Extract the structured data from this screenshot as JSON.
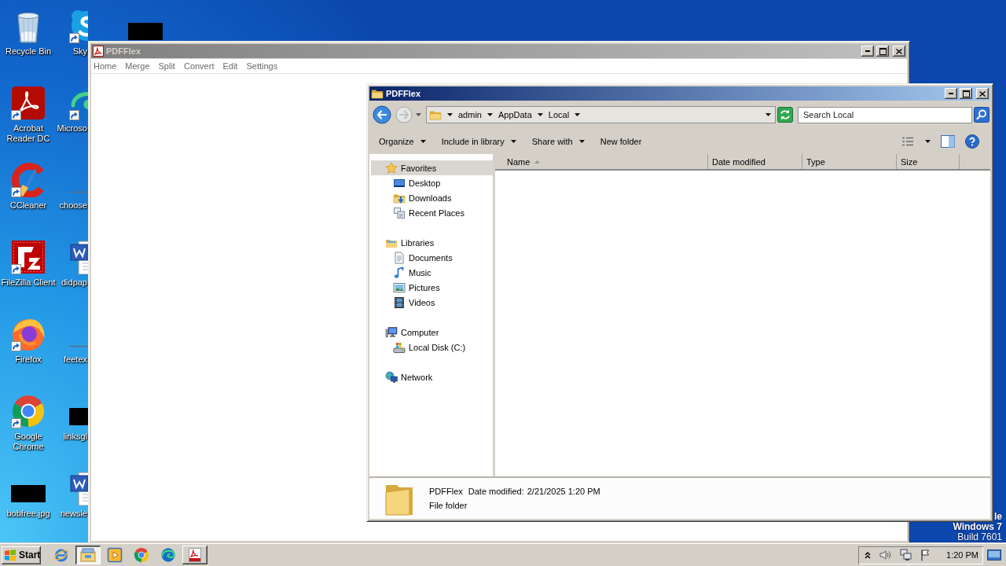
{
  "desktop": {
    "columns": [
      [
        {
          "label": "Recycle Bin",
          "kind": "recycle-bin",
          "shortcut": false
        },
        {
          "label": "Acrobat Reader DC",
          "kind": "acrobat",
          "shortcut": true
        },
        {
          "label": "CCleaner",
          "kind": "ccleaner",
          "shortcut": true
        },
        {
          "label": "FileZilla Client",
          "kind": "filezilla",
          "shortcut": true
        },
        {
          "label": "Firefox",
          "kind": "firefox",
          "shortcut": true
        },
        {
          "label": "Google Chrome",
          "kind": "chrome",
          "shortcut": true
        },
        {
          "label": "bobfree.jpg",
          "kind": "redacted",
          "shortcut": false
        }
      ],
      [
        {
          "label": "Sky",
          "kind": "skype",
          "shortcut": true
        },
        {
          "label": "Microso",
          "kind": "edge",
          "shortcut": true
        },
        {
          "label": "choose",
          "kind": "line",
          "shortcut": false
        },
        {
          "label": "didpap",
          "kind": "word",
          "shortcut": false
        },
        {
          "label": "feetex",
          "kind": "line",
          "shortcut": false
        },
        {
          "label": "linksgl",
          "kind": "redacted",
          "shortcut": false
        },
        {
          "label": "newsle",
          "kind": "word",
          "shortcut": false
        }
      ],
      [
        {
          "kind": "redacted",
          "shortcut": false
        }
      ]
    ],
    "notice": [
      "le",
      "Windows 7",
      "Build 7601"
    ]
  },
  "back_window": {
    "title": "PDFFlex",
    "active": false,
    "menu": [
      "Home",
      "Merge",
      "Split",
      "Convert",
      "Edit",
      "Settings"
    ]
  },
  "explorer": {
    "title": "PDFFlex",
    "active": true,
    "navigation": {
      "back": {
        "disabled": false
      },
      "forward": {
        "disabled": true
      }
    },
    "breadcrumbs": [
      "admin",
      "AppData",
      "Local"
    ],
    "search": {
      "placeholder": "Search Local"
    },
    "toolbar": [
      {
        "label": "Organize",
        "dropdown": true
      },
      {
        "label": "Include in library",
        "dropdown": true
      },
      {
        "label": "Share with",
        "dropdown": true
      },
      {
        "label": "New folder",
        "dropdown": false
      }
    ],
    "nav": [
      {
        "label": "Favorites",
        "kind": "star",
        "selected": true,
        "children": [
          {
            "label": "Desktop",
            "kind": "desktop",
            "selected": false
          },
          {
            "label": "Downloads",
            "kind": "downloads",
            "selected": false
          },
          {
            "label": "Recent Places",
            "kind": "recent",
            "selected": false
          }
        ]
      },
      {
        "label": "Libraries",
        "kind": "libraries",
        "selected": false,
        "children": [
          {
            "label": "Documents",
            "kind": "documents",
            "selected": false
          },
          {
            "label": "Music",
            "kind": "music",
            "selected": false
          },
          {
            "label": "Pictures",
            "kind": "pictures",
            "selected": false
          },
          {
            "label": "Videos",
            "kind": "videos",
            "selected": false
          }
        ]
      },
      {
        "label": "Computer",
        "kind": "computer",
        "selected": false,
        "children": [
          {
            "label": "Local Disk (C:)",
            "kind": "disk",
            "selected": false
          }
        ]
      },
      {
        "label": "Network",
        "kind": "network",
        "selected": false
      }
    ],
    "columns": [
      {
        "label": "Name",
        "sorted": true
      },
      {
        "label": "Date modified",
        "sorted": false
      },
      {
        "label": "Type",
        "sorted": false
      },
      {
        "label": "Size",
        "sorted": false
      }
    ],
    "details": {
      "name": "PDFFlex",
      "date_label": "Date modified:",
      "date_value": "2/21/2025 1:20 PM",
      "type": "File folder"
    }
  },
  "taskbar": {
    "start": "Start",
    "items": [
      {
        "kind": "ie",
        "open": false,
        "active": false
      },
      {
        "kind": "explorer",
        "open": true,
        "active": true
      },
      {
        "kind": "media-player",
        "open": false,
        "active": false
      },
      {
        "kind": "chrome",
        "open": false,
        "active": false
      },
      {
        "kind": "edge",
        "open": false,
        "active": false
      },
      {
        "kind": "pdf",
        "open": true,
        "active": false
      }
    ],
    "clock": "1:20 PM"
  }
}
